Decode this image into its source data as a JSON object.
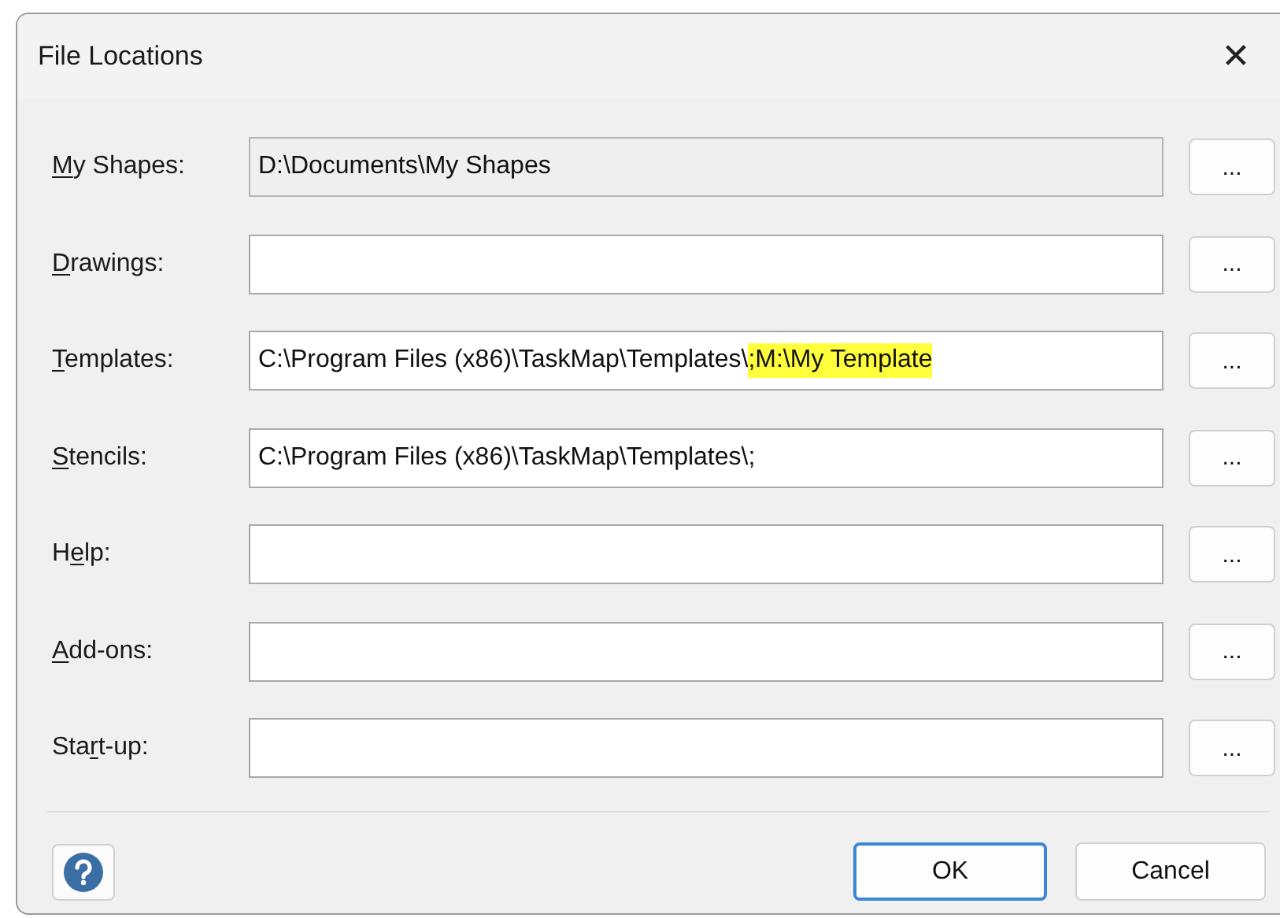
{
  "window": {
    "title": "File Locations",
    "close_glyph": "✕"
  },
  "locations": [
    {
      "access_key": "M",
      "label_end": "y Shapes:",
      "value": "D:\\Documents\\My Shapes",
      "read_only": true,
      "browse": "..."
    },
    {
      "access_key": "D",
      "label_end": "rawings:",
      "read_only": false,
      "browse": "..."
    },
    {
      "access_key": "T",
      "label_end": "emplates:",
      "value": "C:\\Program Files (x86)\\TaskMap\\Templates\\",
      "highlighted": ";M:\\My Template",
      "read_only": false,
      "browse": "..."
    },
    {
      "access_key": "S",
      "label_end": "tencils:",
      "value": "C:\\Program Files (x86)\\TaskMap\\Templates\\;",
      "read_only": false,
      "browse": "..."
    },
    {
      "label_start": "H",
      "access_key": "e",
      "label_end": "lp:",
      "read_only": false,
      "browse": "..."
    },
    {
      "access_key": "A",
      "label_end": "dd-ons:",
      "read_only": false,
      "browse": "..."
    },
    {
      "label_start": "Sta",
      "access_key": "r",
      "label_end": "t-up:",
      "read_only": false,
      "browse": "..."
    }
  ],
  "buttons": [
    {
      "label": "OK",
      "default": true
    },
    {
      "label": "Cancel",
      "default": false
    }
  ]
}
